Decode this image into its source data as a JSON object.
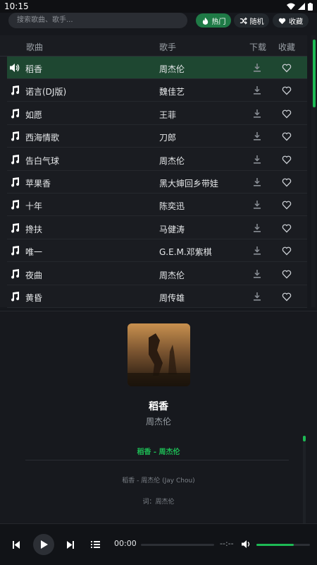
{
  "status": {
    "time": "10:15"
  },
  "search": {
    "placeholder": "搜索歌曲、歌手..."
  },
  "filters": [
    {
      "label": "热门",
      "icon": "fire-icon",
      "active": true
    },
    {
      "label": "随机",
      "icon": "shuffle-icon",
      "active": false
    },
    {
      "label": "收藏",
      "icon": "heart-icon",
      "active": false
    }
  ],
  "table": {
    "headers": {
      "song": "歌曲",
      "artist": "歌手",
      "download": "下载",
      "favorite": "收藏"
    },
    "rows": [
      {
        "title": "稻香",
        "artist": "周杰伦",
        "playing": true
      },
      {
        "title": "诺言(DJ版)",
        "artist": "魏佳艺",
        "playing": false
      },
      {
        "title": "如愿",
        "artist": "王菲",
        "playing": false
      },
      {
        "title": "西海情歌",
        "artist": "刀郎",
        "playing": false
      },
      {
        "title": "告白气球",
        "artist": "周杰伦",
        "playing": false
      },
      {
        "title": "苹果香",
        "artist": "黑大婶回乡带娃",
        "playing": false
      },
      {
        "title": "十年",
        "artist": "陈奕迅",
        "playing": false
      },
      {
        "title": "搀扶",
        "artist": "马健涛",
        "playing": false
      },
      {
        "title": "唯一",
        "artist": "G.E.M.邓紫棋",
        "playing": false
      },
      {
        "title": "夜曲",
        "artist": "周杰伦",
        "playing": false
      },
      {
        "title": "黄昏",
        "artist": "周传雄",
        "playing": false
      }
    ]
  },
  "now_playing": {
    "title": "稻香",
    "artist": "周杰伦",
    "lyric_current": "稻香 - 周杰伦",
    "lyrics": [
      "稻香 - 周杰伦 (Jay Chou)",
      "词：周杰伦"
    ]
  },
  "controls": {
    "current_time": "00:00",
    "total_time": "--:--",
    "progress": 0,
    "volume": 0.7
  },
  "colors": {
    "accent": "#1db954",
    "active_row": "#1e4731",
    "active_pill": "#1f7a46"
  }
}
